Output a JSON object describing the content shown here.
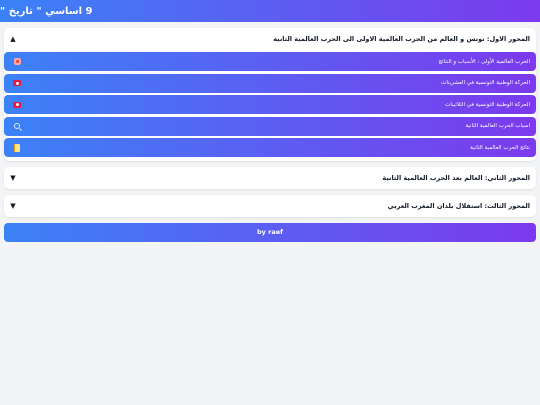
{
  "header": {
    "title": "9 اساسي \" تاريخ \""
  },
  "sections": [
    {
      "title": "المحور الاول: تونس و العالم من الحرب العالمية الاولى الى الحرب العالمية الثانية",
      "arrow": "▲",
      "expanded": true,
      "items": [
        {
          "label": "الحرب العالمية الأولى : الأسباب و النتائج",
          "icon": "alarm-icon"
        },
        {
          "label": "الحركة الوطنية التونسية في العشرينات",
          "icon": "tunisia-flag-icon"
        },
        {
          "label": "الحركة الوطنية التونسية في الثلاثينات",
          "icon": "tunisia-flag-icon"
        },
        {
          "label": "اسباب الحرب العالمية الثانية",
          "icon": "magnifier-icon"
        },
        {
          "label": "نتائج الحرب العالمية الثانية",
          "icon": "scroll-icon"
        }
      ]
    },
    {
      "title": "المحور الثاني: العالم بعد الحرب العالمية الثانية",
      "arrow": "▼",
      "expanded": false
    },
    {
      "title": "المحور الثالث: استقلال بلدان المغرب العربي",
      "arrow": "▼",
      "expanded": false
    }
  ],
  "footer": {
    "label": "by raef"
  },
  "colors": {
    "gradient_start": "#3b82f6",
    "gradient_end": "#7c3aed"
  }
}
